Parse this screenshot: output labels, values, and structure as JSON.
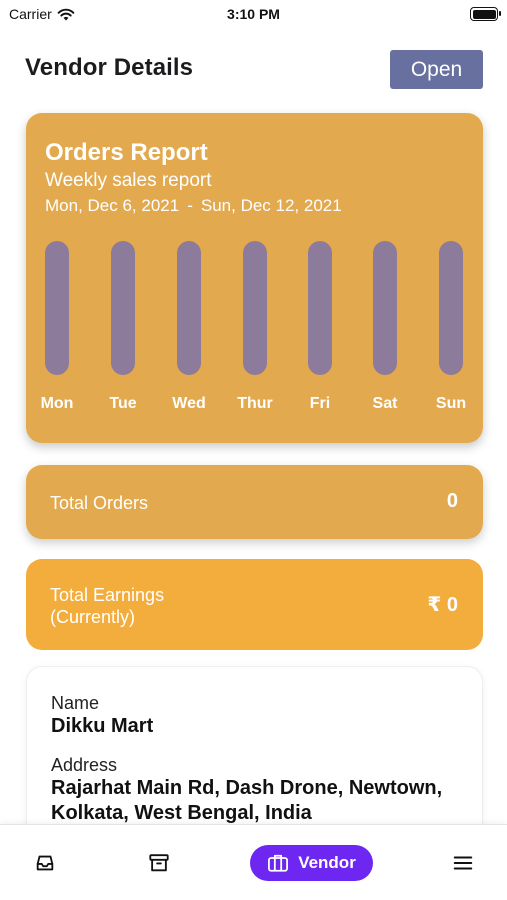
{
  "status_bar": {
    "carrier": "Carrier",
    "time": "3:10 PM"
  },
  "header": {
    "title": "Vendor Details",
    "status_button": "Open",
    "status_button_color": "#67709f"
  },
  "orders_report": {
    "title": "Orders Report",
    "subtitle": "Weekly sales report",
    "range_start": "Mon, Dec 6, 2021",
    "range_separator": "-",
    "range_end": "Sun, Dec 12, 2021",
    "card_color": "#e3a94e",
    "bar_track_color": "#8d7b9b"
  },
  "chart_data": {
    "type": "bar",
    "title": "Orders Report",
    "categories": [
      "Mon",
      "Tue",
      "Wed",
      "Thur",
      "Fri",
      "Sat",
      "Sun"
    ],
    "values": [
      0,
      0,
      0,
      0,
      0,
      0,
      0
    ],
    "xlabel": "",
    "ylabel": "",
    "grid": false
  },
  "total_orders": {
    "label": "Total Orders",
    "value": "0"
  },
  "total_earnings": {
    "label_line1": "Total Earnings",
    "label_line2": "(Currently)",
    "value": "₹ 0",
    "card_color": "#f3ad3d"
  },
  "vendor_info": {
    "name_label": "Name",
    "name_value": "Dikku Mart",
    "address_label": "Address",
    "address_line1": "Rajarhat Main Rd, Dash Drone, Newtown,",
    "address_line2": "Kolkata, West Bengal, India"
  },
  "bottom_nav": {
    "items": [
      {
        "icon": "inbox-icon"
      },
      {
        "icon": "archive-icon"
      },
      {
        "icon": "briefcase-icon",
        "label": "Vendor",
        "active": true
      },
      {
        "icon": "menu-icon"
      }
    ],
    "active_color": "#6d27f1"
  }
}
